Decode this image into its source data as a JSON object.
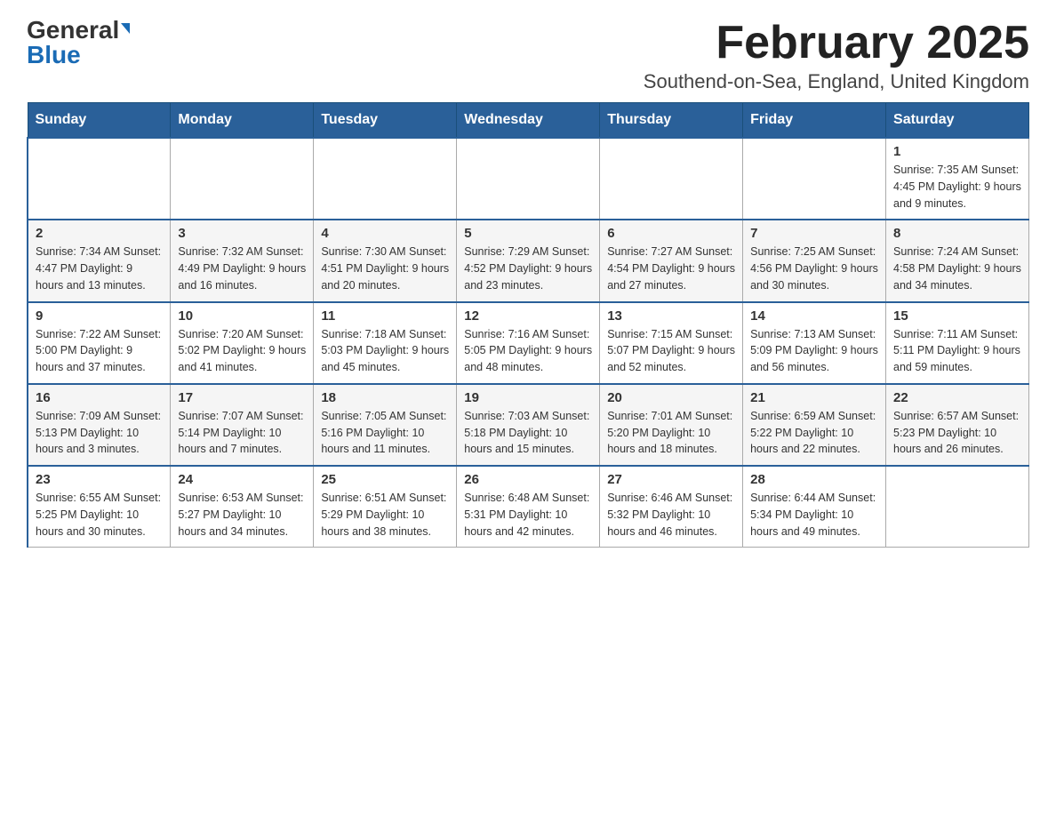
{
  "header": {
    "logo_general": "General",
    "logo_blue": "Blue",
    "month_title": "February 2025",
    "location": "Southend-on-Sea, England, United Kingdom"
  },
  "days_of_week": [
    "Sunday",
    "Monday",
    "Tuesday",
    "Wednesday",
    "Thursday",
    "Friday",
    "Saturday"
  ],
  "weeks": [
    {
      "days": [
        {
          "num": "",
          "info": ""
        },
        {
          "num": "",
          "info": ""
        },
        {
          "num": "",
          "info": ""
        },
        {
          "num": "",
          "info": ""
        },
        {
          "num": "",
          "info": ""
        },
        {
          "num": "",
          "info": ""
        },
        {
          "num": "1",
          "info": "Sunrise: 7:35 AM\nSunset: 4:45 PM\nDaylight: 9 hours and 9 minutes."
        }
      ]
    },
    {
      "days": [
        {
          "num": "2",
          "info": "Sunrise: 7:34 AM\nSunset: 4:47 PM\nDaylight: 9 hours and 13 minutes."
        },
        {
          "num": "3",
          "info": "Sunrise: 7:32 AM\nSunset: 4:49 PM\nDaylight: 9 hours and 16 minutes."
        },
        {
          "num": "4",
          "info": "Sunrise: 7:30 AM\nSunset: 4:51 PM\nDaylight: 9 hours and 20 minutes."
        },
        {
          "num": "5",
          "info": "Sunrise: 7:29 AM\nSunset: 4:52 PM\nDaylight: 9 hours and 23 minutes."
        },
        {
          "num": "6",
          "info": "Sunrise: 7:27 AM\nSunset: 4:54 PM\nDaylight: 9 hours and 27 minutes."
        },
        {
          "num": "7",
          "info": "Sunrise: 7:25 AM\nSunset: 4:56 PM\nDaylight: 9 hours and 30 minutes."
        },
        {
          "num": "8",
          "info": "Sunrise: 7:24 AM\nSunset: 4:58 PM\nDaylight: 9 hours and 34 minutes."
        }
      ]
    },
    {
      "days": [
        {
          "num": "9",
          "info": "Sunrise: 7:22 AM\nSunset: 5:00 PM\nDaylight: 9 hours and 37 minutes."
        },
        {
          "num": "10",
          "info": "Sunrise: 7:20 AM\nSunset: 5:02 PM\nDaylight: 9 hours and 41 minutes."
        },
        {
          "num": "11",
          "info": "Sunrise: 7:18 AM\nSunset: 5:03 PM\nDaylight: 9 hours and 45 minutes."
        },
        {
          "num": "12",
          "info": "Sunrise: 7:16 AM\nSunset: 5:05 PM\nDaylight: 9 hours and 48 minutes."
        },
        {
          "num": "13",
          "info": "Sunrise: 7:15 AM\nSunset: 5:07 PM\nDaylight: 9 hours and 52 minutes."
        },
        {
          "num": "14",
          "info": "Sunrise: 7:13 AM\nSunset: 5:09 PM\nDaylight: 9 hours and 56 minutes."
        },
        {
          "num": "15",
          "info": "Sunrise: 7:11 AM\nSunset: 5:11 PM\nDaylight: 9 hours and 59 minutes."
        }
      ]
    },
    {
      "days": [
        {
          "num": "16",
          "info": "Sunrise: 7:09 AM\nSunset: 5:13 PM\nDaylight: 10 hours and 3 minutes."
        },
        {
          "num": "17",
          "info": "Sunrise: 7:07 AM\nSunset: 5:14 PM\nDaylight: 10 hours and 7 minutes."
        },
        {
          "num": "18",
          "info": "Sunrise: 7:05 AM\nSunset: 5:16 PM\nDaylight: 10 hours and 11 minutes."
        },
        {
          "num": "19",
          "info": "Sunrise: 7:03 AM\nSunset: 5:18 PM\nDaylight: 10 hours and 15 minutes."
        },
        {
          "num": "20",
          "info": "Sunrise: 7:01 AM\nSunset: 5:20 PM\nDaylight: 10 hours and 18 minutes."
        },
        {
          "num": "21",
          "info": "Sunrise: 6:59 AM\nSunset: 5:22 PM\nDaylight: 10 hours and 22 minutes."
        },
        {
          "num": "22",
          "info": "Sunrise: 6:57 AM\nSunset: 5:23 PM\nDaylight: 10 hours and 26 minutes."
        }
      ]
    },
    {
      "days": [
        {
          "num": "23",
          "info": "Sunrise: 6:55 AM\nSunset: 5:25 PM\nDaylight: 10 hours and 30 minutes."
        },
        {
          "num": "24",
          "info": "Sunrise: 6:53 AM\nSunset: 5:27 PM\nDaylight: 10 hours and 34 minutes."
        },
        {
          "num": "25",
          "info": "Sunrise: 6:51 AM\nSunset: 5:29 PM\nDaylight: 10 hours and 38 minutes."
        },
        {
          "num": "26",
          "info": "Sunrise: 6:48 AM\nSunset: 5:31 PM\nDaylight: 10 hours and 42 minutes."
        },
        {
          "num": "27",
          "info": "Sunrise: 6:46 AM\nSunset: 5:32 PM\nDaylight: 10 hours and 46 minutes."
        },
        {
          "num": "28",
          "info": "Sunrise: 6:44 AM\nSunset: 5:34 PM\nDaylight: 10 hours and 49 minutes."
        },
        {
          "num": "",
          "info": ""
        }
      ]
    }
  ]
}
